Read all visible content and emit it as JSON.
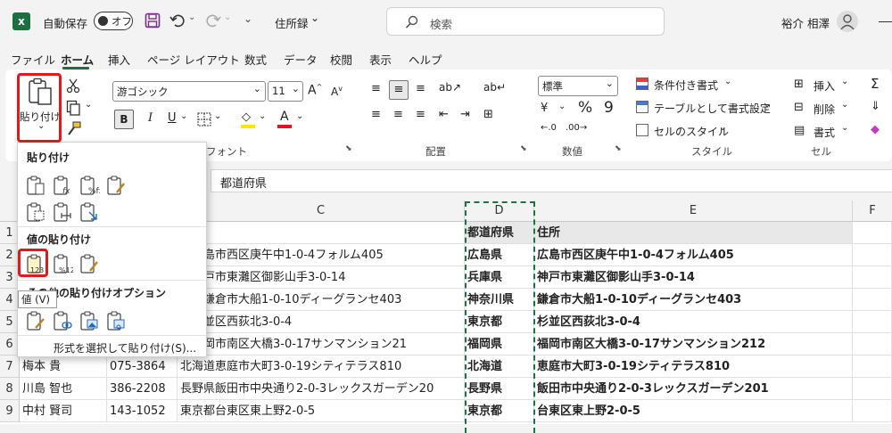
{
  "titlebar": {
    "autosave_label": "自動保存",
    "autosave_state": "オフ",
    "filename": "住所録",
    "search_placeholder": "検索",
    "user_name": "裕介 相澤"
  },
  "tabs": [
    "ファイル",
    "ホーム",
    "挿入",
    "ページ レイアウト",
    "数式",
    "データ",
    "校閲",
    "表示",
    "ヘルプ"
  ],
  "ribbon": {
    "paste_label": "貼り付け",
    "font_name": "游ゴシック",
    "font_size": "11",
    "font_group": "フォント",
    "align_group": "配置",
    "number_format": "標準",
    "number_group": "数値",
    "cond_format": "条件付き書式",
    "table_format": "テーブルとして書式設定",
    "cell_style": "セルのスタイル",
    "style_group": "スタイル",
    "insert": "挿入",
    "delete": "削除",
    "format": "書式",
    "cell_group": "セル",
    "bold": "B"
  },
  "formula_bar": {
    "value": "都道府県"
  },
  "paste_menu": {
    "section_paste": "貼り付け",
    "section_values": "値の貼り付け",
    "section_other": "その他の貼り付けオプション",
    "tooltip": "値 (V)",
    "special": "形式を選択して貼り付け(S)..."
  },
  "columns": [
    "C",
    "D",
    "E",
    "F"
  ],
  "rows": [
    {
      "num": "1",
      "a": "",
      "b": "",
      "c": "",
      "d": "都道府県",
      "e": "住所"
    },
    {
      "num": "2",
      "a": "",
      "b": "",
      "c": "県広島市西区庚午中1-0-4フォルム405",
      "d": "広島県",
      "e": "広島市西区庚午中1-0-4フォルム405"
    },
    {
      "num": "3",
      "a": "",
      "b": "",
      "c": "県神戸市東灘区御影山手3-0-14",
      "d": "兵庫県",
      "e": "神戸市東灘区御影山手3-0-14"
    },
    {
      "num": "4",
      "a": "",
      "b": "",
      "c": "川県鎌倉市大船1-0-10ディーグランセ403",
      "d": "神奈川県",
      "e": "鎌倉市大船1-0-10ディーグランセ403"
    },
    {
      "num": "5",
      "a": "",
      "b": "",
      "c": "都杉並区西荻北3-0-4",
      "d": "東京都",
      "e": "杉並区西荻北3-0-4"
    },
    {
      "num": "6",
      "a": "",
      "b": "",
      "c": "県福岡市南区大橋3-0-17サンマンション21",
      "d": "福岡県",
      "e": "福岡市南区大橋3-0-17サンマンション212"
    },
    {
      "num": "7",
      "a": "梅本 貴",
      "b": "075-3864",
      "c": "北海道恵庭市大町3-0-19シティテラス810",
      "d": "北海道",
      "e": "恵庭市大町3-0-19シティテラス810"
    },
    {
      "num": "8",
      "a": "川島 智也",
      "b": "386-2208",
      "c": "長野県飯田市中央通り2-0-3レックスガーデン20",
      "d": "長野県",
      "e": "飯田市中央通り2-0-3レックスガーデン201"
    },
    {
      "num": "9",
      "a": "中村 賢司",
      "b": "143-1052",
      "c": "東京都台東区東上野2-0-5",
      "d": "東京都",
      "e": "台東区東上野2-0-5"
    }
  ]
}
